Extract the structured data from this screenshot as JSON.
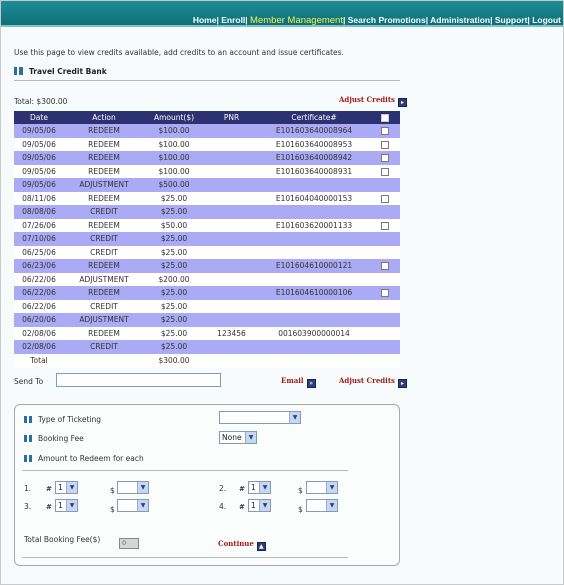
{
  "nav": {
    "items": [
      "Home|",
      "Enroll|",
      "Member Management",
      "|",
      "Search Promotions",
      "|",
      "Administration|",
      "Support|",
      "Logout"
    ],
    "active": "Member Management"
  },
  "intro": "Use this page to view credits available, add credits to an account and issue certificates.",
  "section_title": "Travel Credit Bank",
  "total_label": "Total: $300.00",
  "adjust_credits": "Adjust Credits",
  "table": {
    "headers": [
      "Date",
      "Action",
      "Amount($)",
      "PNR",
      "Certificate#"
    ],
    "rows": [
      {
        "date": "09/05/06",
        "action": "REDEEM",
        "amount": "$100.00",
        "pnr": "",
        "cert": "E101603640008964",
        "checkbox": true
      },
      {
        "date": "09/05/06",
        "action": "REDEEM",
        "amount": "$100.00",
        "pnr": "",
        "cert": "E101603640008953",
        "checkbox": true
      },
      {
        "date": "09/05/06",
        "action": "REDEEM",
        "amount": "$100.00",
        "pnr": "",
        "cert": "E101603640008942",
        "checkbox": true
      },
      {
        "date": "09/05/06",
        "action": "REDEEM",
        "amount": "$100.00",
        "pnr": "",
        "cert": "E101603640008931",
        "checkbox": true
      },
      {
        "date": "09/05/06",
        "action": "ADJUSTMENT",
        "amount": "$500.00",
        "pnr": "",
        "cert": "",
        "checkbox": false
      },
      {
        "date": "08/11/06",
        "action": "REDEEM",
        "amount": "$25.00",
        "pnr": "",
        "cert": "E101604040000153",
        "checkbox": true
      },
      {
        "date": "08/08/06",
        "action": "CREDIT",
        "amount": "$25.00",
        "pnr": "",
        "cert": "",
        "checkbox": false
      },
      {
        "date": "07/26/06",
        "action": "REDEEM",
        "amount": "$50.00",
        "pnr": "",
        "cert": "E101603620001133",
        "checkbox": true
      },
      {
        "date": "07/10/06",
        "action": "CREDIT",
        "amount": "$25.00",
        "pnr": "",
        "cert": "",
        "checkbox": false
      },
      {
        "date": "06/25/06",
        "action": "CREDIT",
        "amount": "$25.00",
        "pnr": "",
        "cert": "",
        "checkbox": false
      },
      {
        "date": "06/23/06",
        "action": "REDEEM",
        "amount": "$25.00",
        "pnr": "",
        "cert": "E101604610000121",
        "checkbox": true
      },
      {
        "date": "06/22/06",
        "action": "ADJUSTMENT",
        "amount": "$200.00",
        "pnr": "",
        "cert": "",
        "checkbox": false
      },
      {
        "date": "06/22/06",
        "action": "REDEEM",
        "amount": "$25.00",
        "pnr": "",
        "cert": "E101604610000106",
        "checkbox": true
      },
      {
        "date": "06/22/06",
        "action": "CREDIT",
        "amount": "$25.00",
        "pnr": "",
        "cert": "",
        "checkbox": false
      },
      {
        "date": "06/20/06",
        "action": "ADJUSTMENT",
        "amount": "$25.00",
        "pnr": "",
        "cert": "",
        "checkbox": false
      },
      {
        "date": "02/08/06",
        "action": "REDEEM",
        "amount": "$25.00",
        "pnr": "123456",
        "cert": "001603900000014",
        "checkbox": false
      },
      {
        "date": "02/08/06",
        "action": "CREDIT",
        "amount": "$25.00",
        "pnr": "",
        "cert": "",
        "checkbox": false
      }
    ],
    "total_label": "Total",
    "total_value": "$300.00"
  },
  "send_to_label": "Send To",
  "email_label": "Email",
  "form": {
    "type_of_ticketing": "Type of Ticketing",
    "booking_fee": "Booking Fee",
    "booking_fee_value": "None",
    "amount_to_redeem": "Amount to Redeem for each",
    "slots": [
      {
        "n": "1.",
        "hash": "#",
        "qty": "1",
        "dollar": "$"
      },
      {
        "n": "2.",
        "hash": "#",
        "qty": "1",
        "dollar": "$"
      },
      {
        "n": "3.",
        "hash": "#",
        "qty": "1",
        "dollar": "$"
      },
      {
        "n": "4.",
        "hash": "#",
        "qty": "1",
        "dollar": "$"
      }
    ],
    "total_booking_fee": "Total Booking Fee($)",
    "total_booking_fee_value": "0",
    "continue": "Continue"
  },
  "colors": {
    "nav_bg": "#127a83",
    "table_header": "#2c3172",
    "row_dark": "#aaaaf5",
    "link_red": "#a01b1b"
  }
}
